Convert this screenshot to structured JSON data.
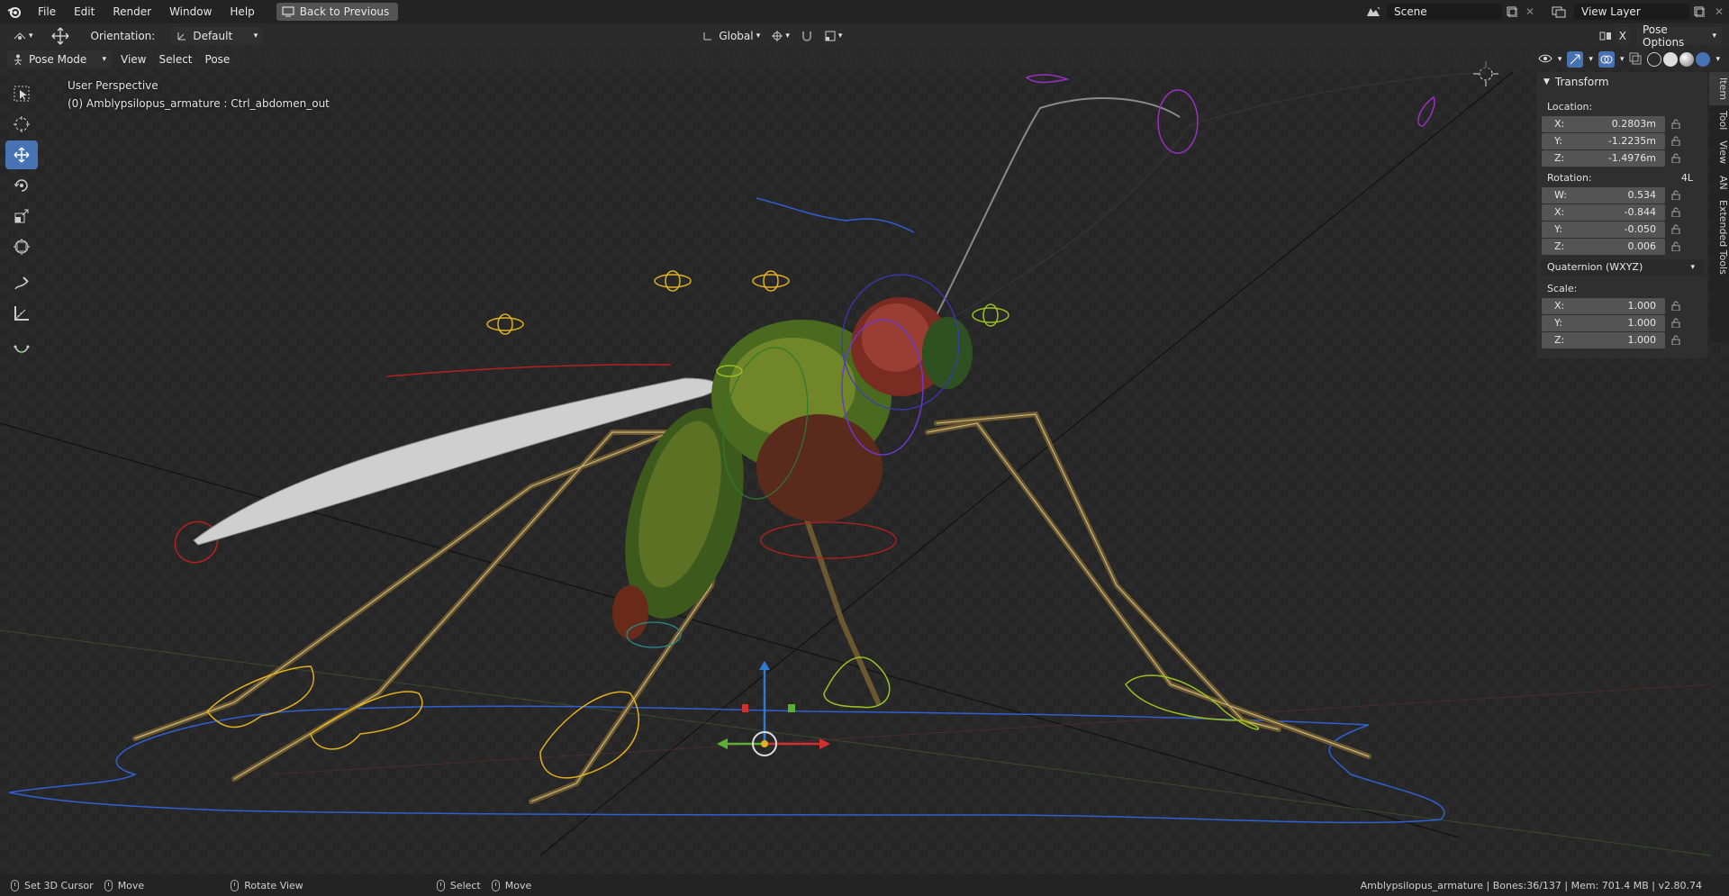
{
  "topbar": {
    "menus": [
      "File",
      "Edit",
      "Render",
      "Window",
      "Help"
    ],
    "back_button": "Back to Previous",
    "scene": "Scene",
    "view_layer": "View Layer"
  },
  "header": {
    "orientation_label": "Orientation:",
    "orientation_value": "Default",
    "transform_orientation": "Global",
    "pose_options": "Pose Options",
    "x_mirror": "X"
  },
  "viewport_header": {
    "mode": "Pose Mode",
    "menus": [
      "View",
      "Select",
      "Pose"
    ]
  },
  "viewport": {
    "perspective": "User Perspective",
    "active_object": "(0) Amblypsilopus_armature : Ctrl_abdomen_out"
  },
  "npanel": {
    "title": "Transform",
    "location_label": "Location:",
    "location": [
      {
        "axis": "X:",
        "value": "0.2803m"
      },
      {
        "axis": "Y:",
        "value": "-1.2235m"
      },
      {
        "axis": "Z:",
        "value": "-1.4976m"
      }
    ],
    "rotation_label": "Rotation:",
    "rotation_badge": "4L",
    "rotation": [
      {
        "axis": "W:",
        "value": "0.534"
      },
      {
        "axis": "X:",
        "value": "-0.844"
      },
      {
        "axis": "Y:",
        "value": "-0.050"
      },
      {
        "axis": "Z:",
        "value": "0.006"
      }
    ],
    "rotation_mode": "Quaternion (WXYZ)",
    "scale_label": "Scale:",
    "scale": [
      {
        "axis": "X:",
        "value": "1.000"
      },
      {
        "axis": "Y:",
        "value": "1.000"
      },
      {
        "axis": "Z:",
        "value": "1.000"
      }
    ]
  },
  "sidetabs": [
    "Item",
    "Tool",
    "View",
    "AN",
    "Extended Tools"
  ],
  "statusbar": {
    "set_cursor": "Set 3D Cursor",
    "move1": "Move",
    "rotate_view": "Rotate View",
    "select": "Select",
    "move2": "Move",
    "info": "Amblypsilopus_armature | Bones:36/137 | Mem: 701.4 MB | v2.80.74"
  },
  "colors": {
    "accent": "#4772b3",
    "header": "#2b2b2b",
    "topbar": "#232323"
  }
}
